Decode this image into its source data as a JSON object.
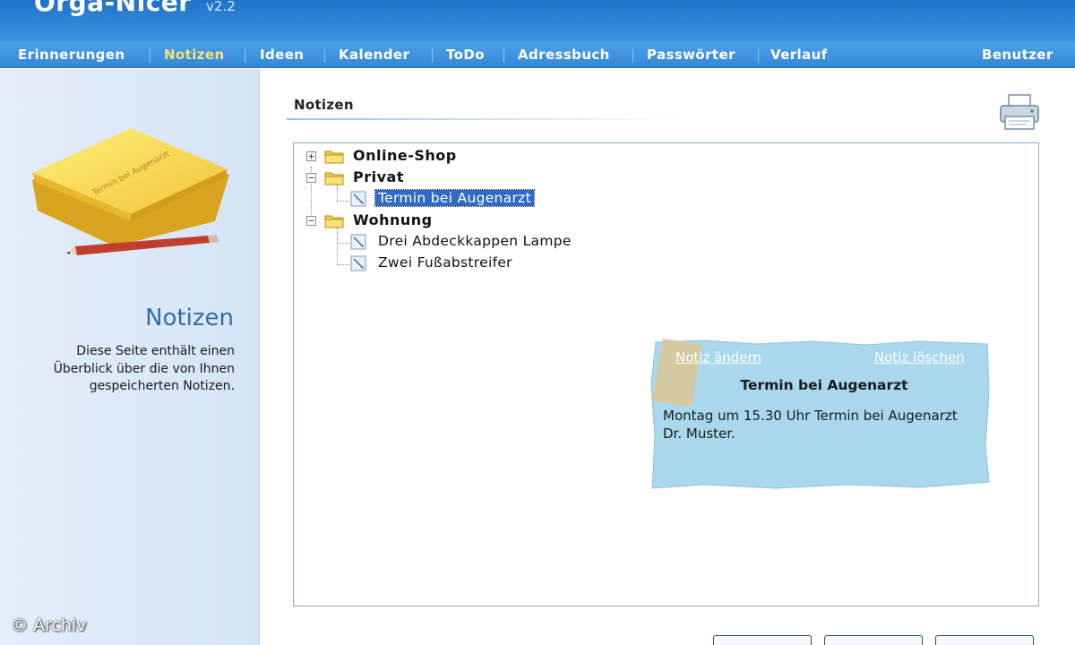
{
  "app": {
    "name": "Orga-Nicer",
    "version": "v2.2"
  },
  "nav": {
    "items": [
      {
        "label": "Erinnerungen"
      },
      {
        "label": "Notizen"
      },
      {
        "label": "Ideen"
      },
      {
        "label": "Kalender"
      },
      {
        "label": "ToDo"
      },
      {
        "label": "Adressbuch"
      },
      {
        "label": "Passwörter"
      },
      {
        "label": "Verlauf"
      }
    ],
    "active": "Notizen",
    "user": "Benutzer"
  },
  "left": {
    "title": "Notizen",
    "description": "Diese Seite enthält einen Überblick über die von Ihnen gespeicherten Notizen.",
    "sticky_text": "Termin bei Augenarzt"
  },
  "content": {
    "title": "Notizen",
    "tree": {
      "folders": [
        {
          "label": "Online-Shop",
          "state": "collapsed",
          "notes": []
        },
        {
          "label": "Privat",
          "state": "expanded",
          "notes": [
            {
              "label": "Termin bei Augenarzt",
              "selected": true
            }
          ]
        },
        {
          "label": "Wohnung",
          "state": "expanded",
          "notes": [
            {
              "label": "Drei Abdeckkappen Lampe"
            },
            {
              "label": "Zwei Fußabstreifer"
            }
          ]
        }
      ]
    },
    "note_card": {
      "edit_link": "Notiz ändern",
      "delete_link": "Notiz löschen",
      "title": "Termin bei Augenarzt",
      "text": "Montag um 15.30 Uhr Termin bei Augenarzt Dr. Muster."
    }
  },
  "watermark": "© Archiv",
  "colors": {
    "header": "#2a82d6",
    "nav_active": "#f5e27a",
    "selection": "#316ac5",
    "note_card": "#a9d8ec"
  },
  "icons": [
    "folder-icon",
    "note-icon",
    "printer-icon",
    "pencil-icon"
  ]
}
